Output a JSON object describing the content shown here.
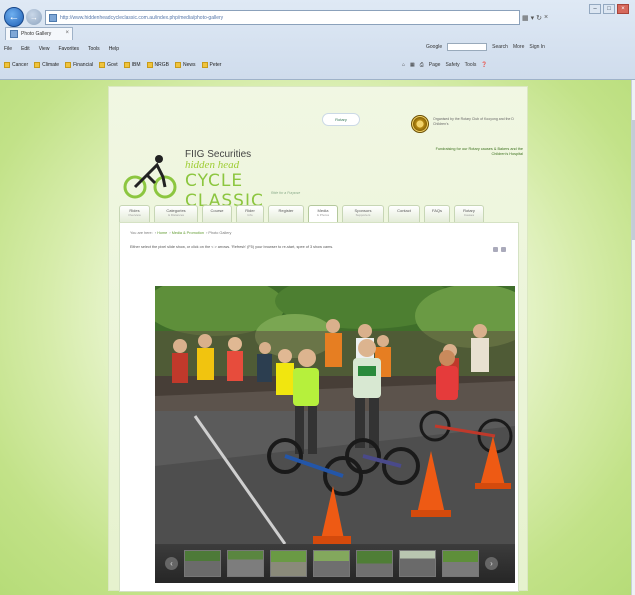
{
  "browser": {
    "url": "http://www.hiddenheadcycleclassic.com.au/index.php/media/photo-gallery",
    "tab_title": "Photo Gallery",
    "menu": [
      "File",
      "Edit",
      "View",
      "Favorites",
      "Tools",
      "Help"
    ],
    "search_provider": "Google",
    "search_tools": [
      "Search",
      "More",
      "Sign In"
    ],
    "favorites": [
      "Cancer",
      "Climate",
      "Financial",
      "Govt",
      "IBM",
      "NRGB",
      "News",
      "Peter"
    ],
    "commands": [
      "Page",
      "Safety",
      "Tools"
    ]
  },
  "site": {
    "partner_badge": "Rotary",
    "rotary_text": "Organised by the Rotary Club of Kooyong and the D Children's",
    "fundraising_text": "Fundraising for our Rotary causes & Bakers and the Children's Hospital",
    "sponsor": "FIIG Securities",
    "event_line1": "hidden head",
    "event_line2": "CYCLE CLASSIC",
    "tagline": "Ride for a Purpose",
    "nav": [
      {
        "label": "Rides",
        "sub": "Overview"
      },
      {
        "label": "Categories",
        "sub": "& Distances"
      },
      {
        "label": "Course",
        "sub": ""
      },
      {
        "label": "Rider",
        "sub": "Info"
      },
      {
        "label": "Register",
        "sub": ""
      },
      {
        "label": "Media",
        "sub": "& Photos"
      },
      {
        "label": "Sponsors",
        "sub": "Supporters"
      },
      {
        "label": "Contact",
        "sub": ""
      },
      {
        "label": "FAQs",
        "sub": ""
      },
      {
        "label": "Rotary",
        "sub": "Causes"
      }
    ],
    "active_tab": "Media",
    "breadcrumb": {
      "prefix": "You are here:",
      "home": "Home",
      "section": "Media & Promotion",
      "current": "Photo Gallery"
    },
    "instructions": "Either select the pixel slide show, or click on the < > arrows. 'Refresh' (F5) your browser to re-start, spee of 3 show cams.",
    "gallery": {
      "prev_label": "‹",
      "next_label": "›",
      "thumb_count": 7
    }
  },
  "colors": {
    "brand_green": "#8cc63f",
    "bg_green": "#c2e288",
    "dark_strip": "#2e2e2e",
    "cone_orange": "#ee5a14"
  },
  "icons": [
    "back-arrow-icon",
    "forward-arrow-icon",
    "rss-icon",
    "home-icon",
    "print-icon",
    "email-icon"
  ]
}
